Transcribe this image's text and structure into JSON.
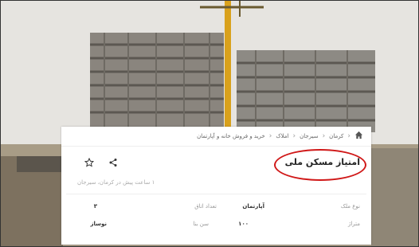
{
  "breadcrumb": {
    "items": [
      "کرمان",
      "سیرجان",
      "املاک",
      "خرید و فروش خانه و آپارتمان"
    ]
  },
  "listing": {
    "title": "امتیاز مسکن ملی",
    "subtitle": "۱ ساعت پیش در کرمان، سیرجان",
    "fields": [
      {
        "label": "نوع ملک",
        "value": "آپارتمان"
      },
      {
        "label": "تعداد اتاق",
        "value": "۳"
      },
      {
        "label": "متراژ",
        "value": "۱۰۰"
      },
      {
        "label": "سن بنا",
        "value": "نوساز"
      }
    ]
  },
  "icons": {
    "home": "home-icon",
    "share": "share-icon",
    "bookmark": "star-icon"
  },
  "colors": {
    "highlight": "#d01818"
  }
}
